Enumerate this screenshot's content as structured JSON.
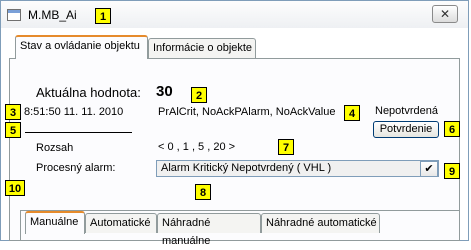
{
  "window": {
    "title": "M.MB_Ai",
    "close_glyph": "✕"
  },
  "tabs": [
    {
      "label": "Stav a ovládanie objektu",
      "active": true
    },
    {
      "label": "Informácie o objekte",
      "active": false
    }
  ],
  "status": {
    "value_label": "Aktuálna hodnota:",
    "value": "30",
    "timestamp": "8:51:50 11. 11. 2010",
    "flags": "PrAlCrit, NoAckPAlarm, NoAckValue",
    "ack_state": "Nepotvrdená",
    "confirm_button": "Potvrdenie",
    "range_label": "Rozsah",
    "range_value": "< 0 , 1 , 5 , 20 >",
    "alarm_label": "Procesný alarm:",
    "alarm_value": "Alarm Kritický Nepotvrdený ( VHL )",
    "alarm_check_glyph": "✔"
  },
  "bottom_tabs": [
    {
      "label": "Manuálne",
      "active": true
    },
    {
      "label": "Automatické",
      "active": false
    },
    {
      "label": "Náhradné manuálne",
      "active": false
    },
    {
      "label": "Náhradné automatické",
      "active": false
    }
  ],
  "badges": [
    "1",
    "2",
    "3",
    "4",
    "5",
    "6",
    "7",
    "8",
    "9",
    "10"
  ]
}
